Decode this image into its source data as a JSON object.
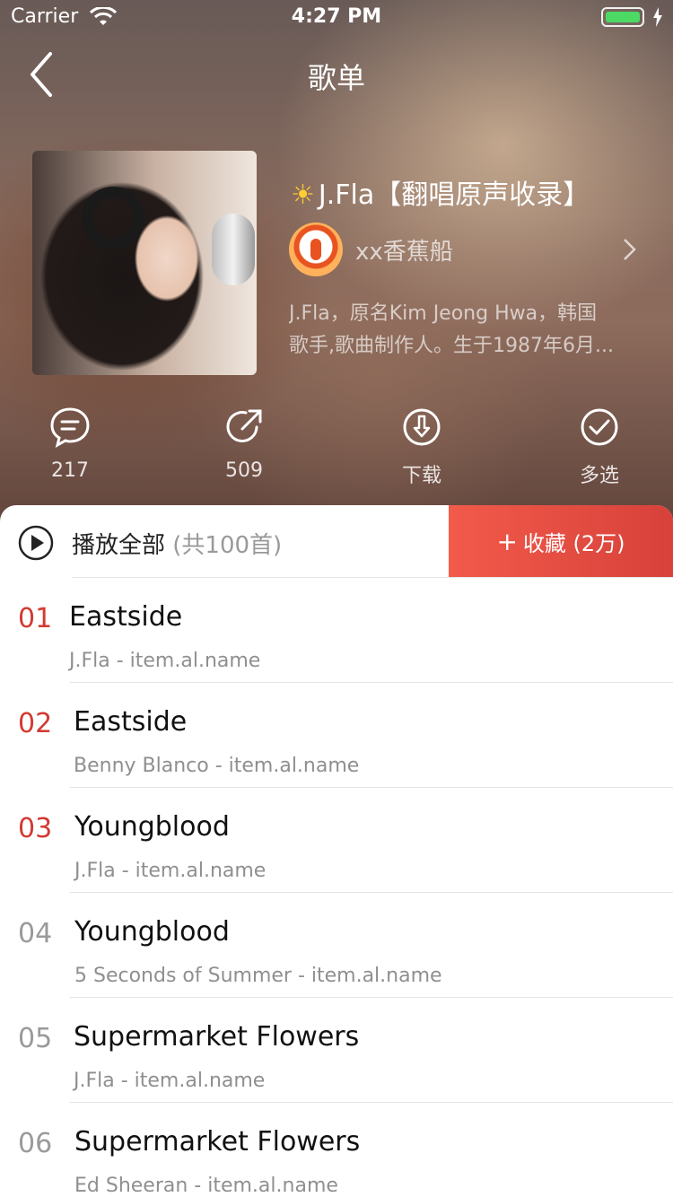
{
  "status_bar": {
    "carrier": "Carrier",
    "time": "4:27 PM"
  },
  "nav": {
    "title": "歌单"
  },
  "playlist": {
    "title": "J.Fla【翻唱原声收录】",
    "creator": "xx香蕉船",
    "description_line1": "J.Fla，原名Kim Jeong Hwa，韩国",
    "description_line2": "歌手,歌曲制作人。生于1987年6月..."
  },
  "actions": [
    {
      "icon": "comment-icon",
      "label": "217"
    },
    {
      "icon": "share-icon",
      "label": "509"
    },
    {
      "icon": "download-icon",
      "label": "下载"
    },
    {
      "icon": "multiselect-icon",
      "label": "多选"
    }
  ],
  "list_header": {
    "play_all": "播放全部",
    "count": "(共100首)",
    "collect": "收藏 (2万)"
  },
  "songs": [
    {
      "index": "01",
      "name": "Eastside",
      "meta": "J.Fla - item.al.name",
      "highlight": true
    },
    {
      "index": "02",
      "name": "Eastside",
      "meta": "Benny Blanco - item.al.name",
      "highlight": true
    },
    {
      "index": "03",
      "name": "Youngblood",
      "meta": "J.Fla - item.al.name",
      "highlight": true
    },
    {
      "index": "04",
      "name": "Youngblood",
      "meta": "5 Seconds of Summer - item.al.name",
      "highlight": false
    },
    {
      "index": "05",
      "name": "Supermarket Flowers",
      "meta": "J.Fla - item.al.name",
      "highlight": false
    },
    {
      "index": "06",
      "name": "Supermarket Flowers",
      "meta": "Ed Sheeran - item.al.name",
      "highlight": false
    }
  ],
  "colors": {
    "accent": "#d33a31",
    "collect_start": "#f25a4a",
    "collect_end": "#d7413a"
  }
}
